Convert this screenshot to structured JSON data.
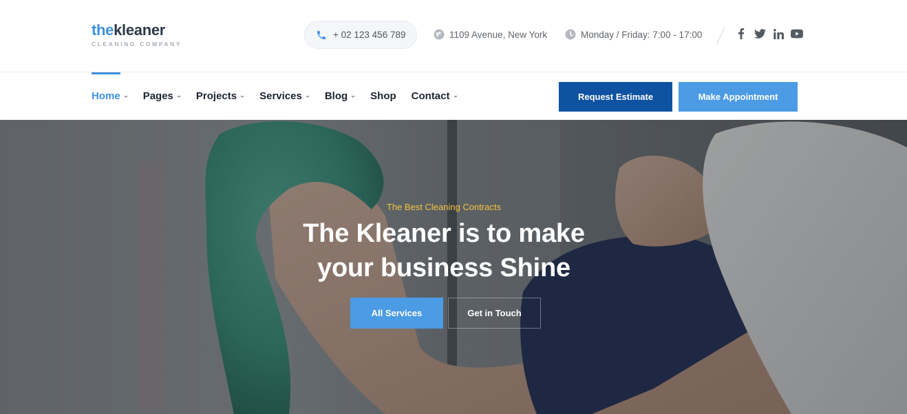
{
  "brand": {
    "logo_the": "the",
    "logo_rest": "kleaner",
    "logo_sub": "CLEANING COMPANY"
  },
  "topbar": {
    "phone": "+ 02 123 456 789",
    "address": "1109 Avenue, New York",
    "hours": "Monday / Friday: 7:00 - 17:00",
    "socials": [
      {
        "icon": "facebook-icon"
      },
      {
        "icon": "twitter-icon"
      },
      {
        "icon": "linkedin-icon"
      },
      {
        "icon": "youtube-icon"
      }
    ]
  },
  "nav": {
    "items": [
      {
        "label": "Home",
        "dropdown": true,
        "active": true
      },
      {
        "label": "Pages",
        "dropdown": true
      },
      {
        "label": "Projects",
        "dropdown": true
      },
      {
        "label": "Services",
        "dropdown": true
      },
      {
        "label": "Blog",
        "dropdown": true
      },
      {
        "label": "Shop",
        "dropdown": false
      },
      {
        "label": "Contact",
        "dropdown": true
      }
    ],
    "request_estimate": "Request Estimate",
    "make_appointment": "Make Appointment"
  },
  "hero": {
    "tagline": "The Best Cleaning Contracts",
    "title_line1": "The Kleaner is to make",
    "title_line2": "your business Shine",
    "btn_services": "All Services",
    "btn_touch": "Get in Touch"
  },
  "colors": {
    "accent": "#3e91e0",
    "dark_button": "#0f52a1",
    "light_button": "#4c9be5",
    "tagline": "#f5c23d"
  }
}
